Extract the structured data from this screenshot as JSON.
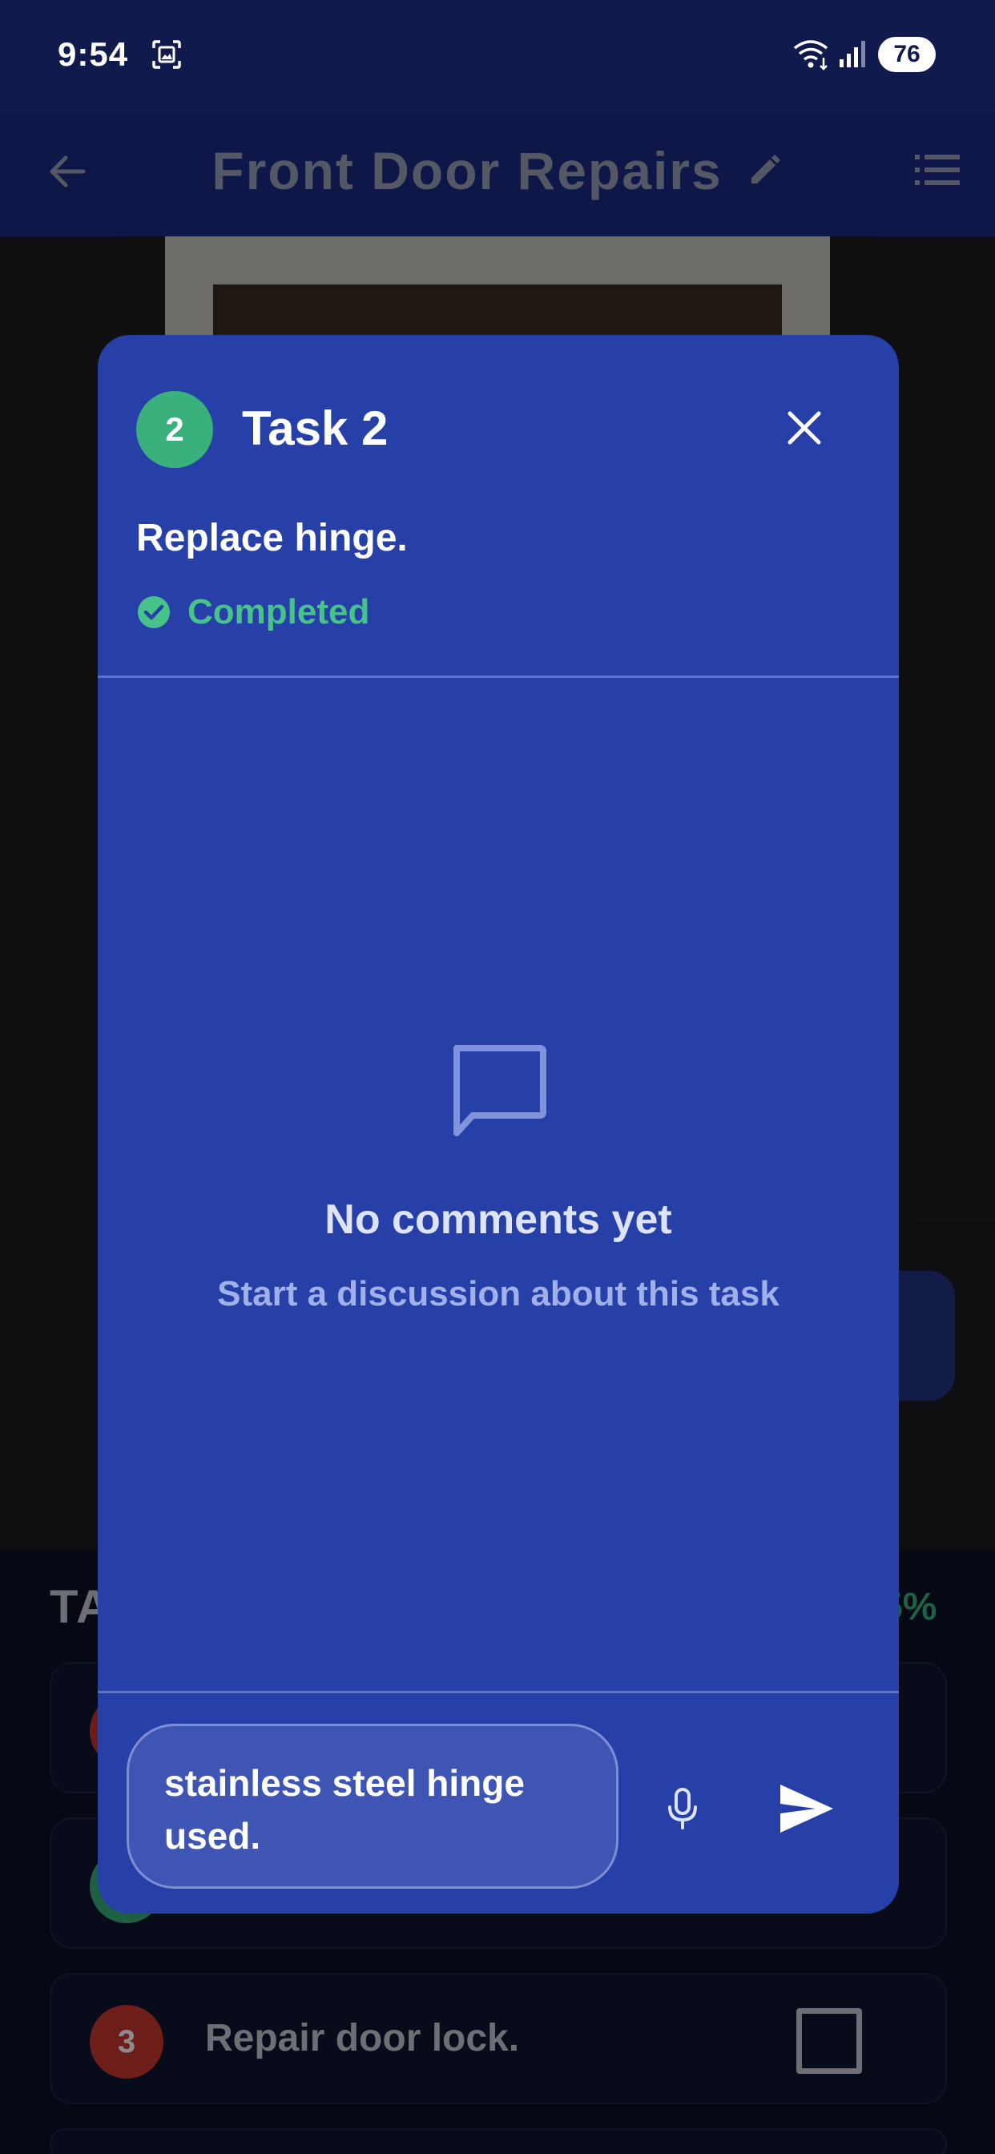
{
  "status_bar": {
    "time": "9:54",
    "battery": "76",
    "icons": [
      "screenshot-icon",
      "wifi-icon",
      "signal-icon"
    ]
  },
  "app_bar": {
    "title": "Front Door Repairs",
    "icons": [
      "back-arrow-icon",
      "edit-pencil-icon",
      "list-icon"
    ]
  },
  "background": {
    "tasks_title": "TA",
    "progress_text": "5%",
    "task_cards": [
      {
        "number": "",
        "text": ""
      },
      {
        "number": "",
        "text": ""
      },
      {
        "number": "3",
        "text": "Repair door lock."
      }
    ]
  },
  "dialog": {
    "badge_number": "2",
    "title": "Task 2",
    "description": "Replace hinge.",
    "status": "Completed",
    "empty_title": "No comments yet",
    "empty_subtitle": "Start a discussion about this task",
    "comment_input_value": "stainless steel hinge used.",
    "icons": [
      "close-icon",
      "check-circle-icon",
      "comment-icon",
      "mic-icon",
      "send-icon"
    ]
  },
  "colors": {
    "status_bar_bg": "#101a4c",
    "app_bar_bg": "#1b2a82",
    "dialog_bg": "#2640a8",
    "accent_green": "#3ab07c",
    "badge_red": "#c8372f"
  }
}
